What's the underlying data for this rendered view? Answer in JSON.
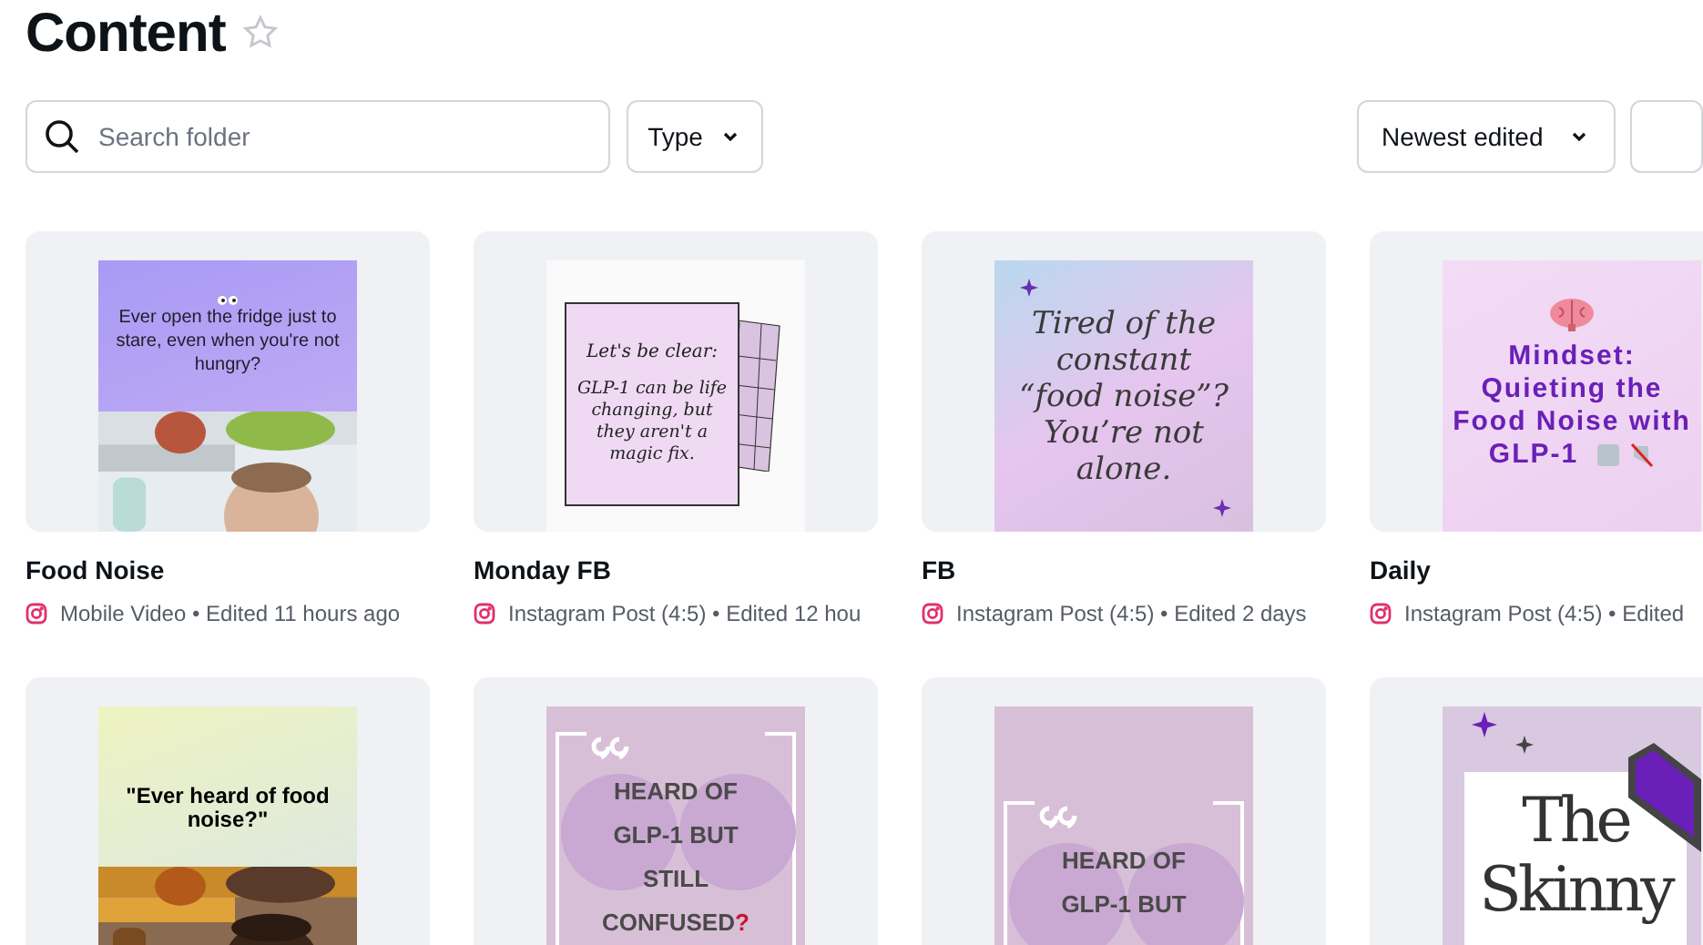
{
  "header": {
    "title": "Content",
    "starred": false
  },
  "toolbar": {
    "search": {
      "placeholder": "Search folder"
    },
    "type_filter": "Type",
    "sort": "Newest edited"
  },
  "designs": [
    {
      "title": "Food Noise",
      "meta": "Mobile Video • Edited 11 hours ago",
      "thumbnail": {
        "kind": "photo-caption",
        "lines": [
          "Ever open the fridge just to stare, even when you're not hungry?"
        ]
      }
    },
    {
      "title": "Monday FB",
      "meta": "Instagram Post (4:5) • Edited 12 hou",
      "thumbnail": {
        "kind": "note",
        "lines": [
          "Let's be clear:",
          "GLP-1 can be life changing, but they aren't a magic fix."
        ]
      }
    },
    {
      "title": "FB",
      "meta": "Instagram Post (4:5) • Edited 2 days",
      "thumbnail": {
        "kind": "script-quote",
        "lines": [
          "Tired of the constant “food noise”? You’re not alone."
        ]
      }
    },
    {
      "title": "Daily",
      "meta": "Instagram Post (4:5) • Edited",
      "thumbnail": {
        "kind": "bold-heading",
        "lines": [
          "Mindset: Quieting the Food Noise with",
          "GLP-1"
        ]
      }
    },
    {
      "thumbnail": {
        "kind": "photo-caption-light",
        "lines": [
          "\"Ever heard of food noise?\""
        ]
      }
    },
    {
      "thumbnail": {
        "kind": "quote-frame",
        "lines": [
          "HEARD OF",
          "GLP-1 BUT",
          "STILL",
          "CONFUSED"
        ],
        "accent": "?"
      }
    },
    {
      "thumbnail": {
        "kind": "quote-frame-low",
        "lines": [
          "HEARD OF",
          "GLP-1 BUT"
        ]
      }
    },
    {
      "thumbnail": {
        "kind": "title-card",
        "lines": [
          "The",
          "Skinny"
        ]
      }
    }
  ]
}
